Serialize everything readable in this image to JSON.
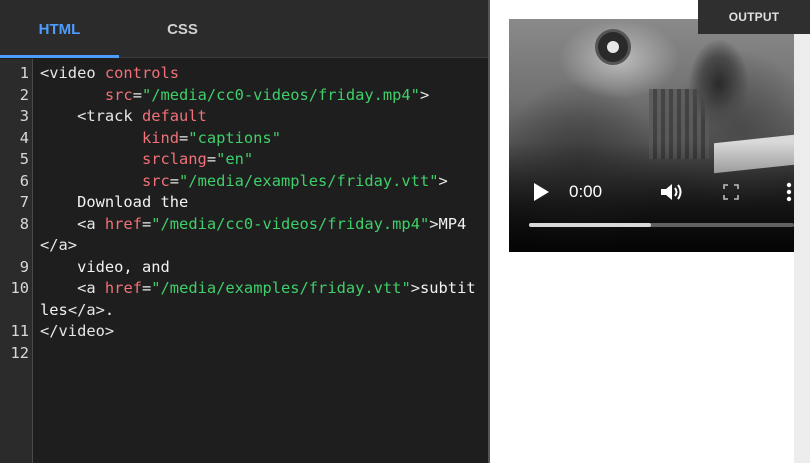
{
  "tabs": [
    {
      "label": "HTML",
      "active": true
    },
    {
      "label": "CSS",
      "active": false
    }
  ],
  "output_label": "OUTPUT",
  "code_lines": [
    {
      "n": "1",
      "tokens": [
        [
          "tg",
          "<video "
        ],
        [
          "at",
          "controls"
        ]
      ]
    },
    {
      "n": "2",
      "tokens": [
        [
          "tx",
          "       "
        ],
        [
          "at",
          "src"
        ],
        [
          "tg",
          "="
        ],
        [
          "vl",
          "\"/media/cc0-videos/friday.mp4\""
        ],
        [
          "tg",
          ">"
        ]
      ]
    },
    {
      "n": "3",
      "tokens": [
        [
          "tx",
          "    "
        ],
        [
          "tg",
          "<track "
        ],
        [
          "at",
          "default"
        ]
      ]
    },
    {
      "n": "4",
      "tokens": [
        [
          "tx",
          "           "
        ],
        [
          "at",
          "kind"
        ],
        [
          "tg",
          "="
        ],
        [
          "vl",
          "\"captions\""
        ]
      ]
    },
    {
      "n": "5",
      "tokens": [
        [
          "tx",
          "           "
        ],
        [
          "at",
          "srclang"
        ],
        [
          "tg",
          "="
        ],
        [
          "vl",
          "\"en\""
        ]
      ]
    },
    {
      "n": "6",
      "tokens": [
        [
          "tx",
          "           "
        ],
        [
          "at",
          "src"
        ],
        [
          "tg",
          "="
        ],
        [
          "vl",
          "\"/media/examples/friday.vtt\""
        ],
        [
          "tg",
          ">"
        ]
      ]
    },
    {
      "n": "7",
      "tokens": [
        [
          "tx",
          "    Download the"
        ]
      ]
    },
    {
      "n": "8",
      "tokens": [
        [
          "tx",
          "    "
        ],
        [
          "tg",
          "<a "
        ],
        [
          "at",
          "href"
        ],
        [
          "tg",
          "="
        ],
        [
          "vl",
          "\"/media/cc0-videos/friday.mp4\""
        ],
        [
          "tg",
          ">"
        ],
        [
          "tx",
          "MP4"
        ],
        [
          "tg",
          "</a>"
        ]
      ]
    },
    {
      "n": "9",
      "tokens": [
        [
          "tx",
          "    video, and"
        ]
      ]
    },
    {
      "n": "10",
      "tokens": [
        [
          "tx",
          "    "
        ],
        [
          "tg",
          "<a"
        ],
        [
          "tx",
          " "
        ],
        [
          "at",
          "href"
        ],
        [
          "tg",
          "="
        ],
        [
          "vl",
          "\"/media/examples/friday.vtt\""
        ],
        [
          "tg",
          ">"
        ],
        [
          "tx",
          "subtitles"
        ],
        [
          "tg",
          "</a>"
        ],
        [
          "tx",
          "."
        ]
      ]
    },
    {
      "n": "11",
      "tokens": [
        [
          "tg",
          "</video>"
        ]
      ]
    },
    {
      "n": "12",
      "tokens": []
    }
  ],
  "video": {
    "time": "0:00",
    "progress": 0.46,
    "play_icon": "play-icon",
    "volume_icon": "volume-icon",
    "fullscreen_icon": "fullscreen-icon",
    "more_icon": "more-options-icon"
  },
  "colors": {
    "editor_bg": "#1e1e1e",
    "tab_active": "#4c9dff",
    "attr": "#f07178",
    "value": "#3fcf6a"
  }
}
